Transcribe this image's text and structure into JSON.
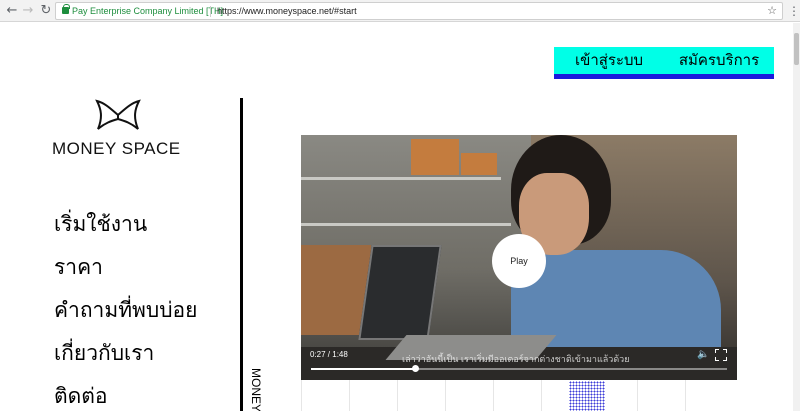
{
  "browser": {
    "secure_label": "Pay Enterprise Company Limited [TH]",
    "url": "https://www.moneyspace.net/#start",
    "back_icon": "arrow-left-icon",
    "forward_icon": "arrow-right-icon",
    "reload_icon": "reload-icon",
    "bookmark_icon": "star-icon",
    "menu_icon": "more-vert-icon"
  },
  "topnav": {
    "login_label": "เข้าสู่ระบบ",
    "register_label": "สมัครบริการ",
    "accent_color": "#00ffe7",
    "underline_color": "#1a1adc"
  },
  "logo": {
    "text": "MONEY SPACE"
  },
  "sidebar": {
    "items": [
      {
        "label": "เริ่มใช้งาน"
      },
      {
        "label": "ราคา"
      },
      {
        "label": "คำถามที่พบบ่อย"
      },
      {
        "label": "เกี่ยวกับเรา"
      },
      {
        "label": "ติดต่อ"
      }
    ]
  },
  "vertical_label": "MONEY",
  "video": {
    "play_label": "Play",
    "time": "0:27 / 1:48",
    "subtitle": "เล่าว่าอันนี้เป็น เราเริ่มมีออเดอร์จากต่างชาติเข้ามาแล้วด้วย",
    "progress": 0.25,
    "volume_icon": "volume-icon",
    "fullscreen_icon": "fullscreen-icon"
  }
}
